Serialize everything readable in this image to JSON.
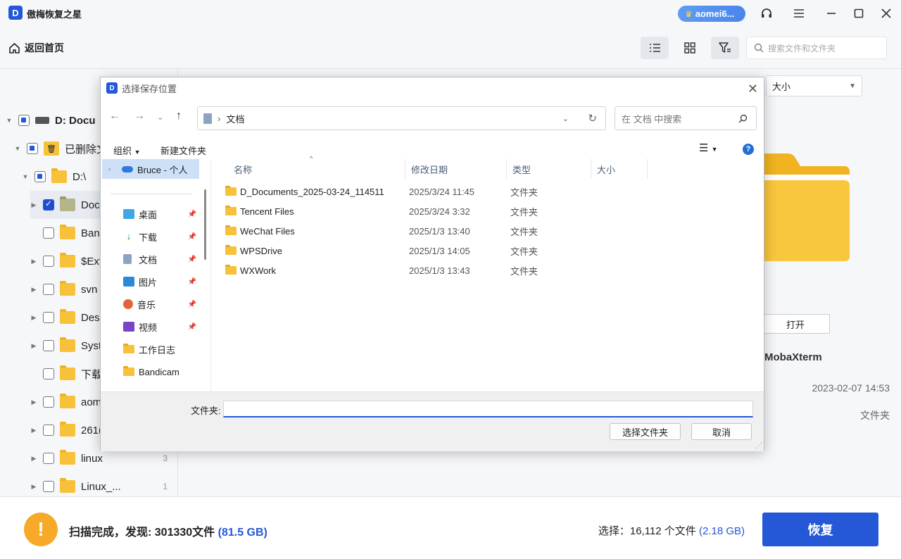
{
  "app": {
    "title": "傲梅恢复之星",
    "logo_letter": "D",
    "user_badge": "aomei6..."
  },
  "toolbar": {
    "back_home": "返回首页",
    "search_placeholder": "搜索文件和文件夹"
  },
  "tree": {
    "root": "D: Docu",
    "deleted": "已删除文",
    "drive": "D:\\",
    "items": [
      {
        "label": "Doc",
        "checked": true,
        "expand": true
      },
      {
        "label": "Band",
        "checked": false,
        "expand": false
      },
      {
        "label": "$Ext",
        "checked": false,
        "expand": true
      },
      {
        "label": "svn",
        "checked": false,
        "expand": true
      },
      {
        "label": "Desk",
        "checked": false,
        "expand": true
      },
      {
        "label": "Syst",
        "checked": false,
        "expand": true
      },
      {
        "label": "下载",
        "checked": false,
        "expand": false
      },
      {
        "label": "aom",
        "checked": false,
        "expand": true
      },
      {
        "label": "261(",
        "checked": false,
        "expand": true
      },
      {
        "label": "linux",
        "checked": false,
        "expand": true,
        "count": "3"
      },
      {
        "label": "Linux_...",
        "checked": false,
        "expand": true,
        "count": "1"
      }
    ]
  },
  "right": {
    "sort_label": "大小",
    "open_button": "打开",
    "file_name": "MobaXterm",
    "file_date": "2023-02-07 14:53",
    "file_type": "文件夹"
  },
  "bottom": {
    "scan_prefix": "扫描完成，发现: 301330文件 ",
    "scan_size": "(81.5 GB)",
    "sel_prefix": "选择：16,112 个文件 ",
    "sel_size": "(2.18 GB)",
    "recover": "恢复"
  },
  "dialog": {
    "title": "选择保存位置",
    "address": "文档",
    "search_placeholder": "在 文档 中搜索",
    "organize": "组织",
    "new_folder": "新建文件夹",
    "nav": {
      "onedrive": "Bruce - 个人",
      "items": [
        "桌面",
        "下载",
        "文档",
        "图片",
        "音乐",
        "视频",
        "工作日志",
        "Bandicam"
      ]
    },
    "columns": {
      "name": "名称",
      "date": "修改日期",
      "type": "类型",
      "size": "大小"
    },
    "files": [
      {
        "name": "D_Documents_2025-03-24_114511",
        "date": "2025/3/24 11:45",
        "type": "文件夹"
      },
      {
        "name": "Tencent Files",
        "date": "2025/3/24 3:32",
        "type": "文件夹"
      },
      {
        "name": "WeChat Files",
        "date": "2025/1/3 13:40",
        "type": "文件夹"
      },
      {
        "name": "WPSDrive",
        "date": "2025/1/3 14:05",
        "type": "文件夹"
      },
      {
        "name": "WXWork",
        "date": "2025/1/3 13:43",
        "type": "文件夹"
      }
    ],
    "folder_label": "文件夹:",
    "folder_value": "",
    "select_button": "选择文件夹",
    "cancel_button": "取消"
  },
  "colors": {
    "accent": "#2458d6",
    "warning": "#f7a928",
    "folder": "#f7c23a"
  }
}
